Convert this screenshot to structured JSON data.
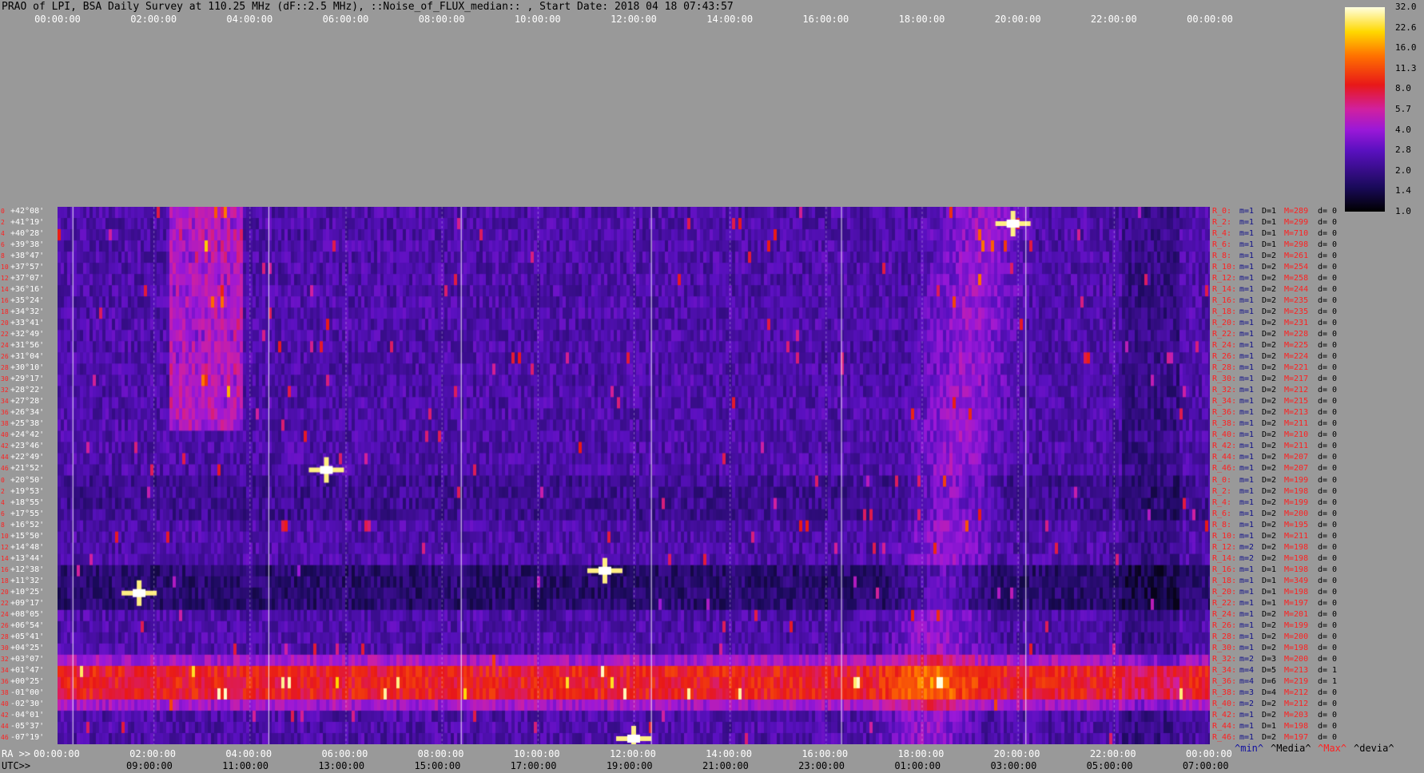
{
  "title": "PRAO of LPI, BSA Daily Survey at 110.25 MHz (dF::2.5 MHz), ::Noise_of_FLUX_median:: , Start Date: 2018 04 18 07:43:57",
  "top_axis": [
    "00:00:00",
    "02:00:00",
    "04:00:00",
    "06:00:00",
    "08:00:00",
    "10:00:00",
    "12:00:00",
    "14:00:00",
    "16:00:00",
    "18:00:00",
    "20:00:00",
    "22:00:00",
    "00:00:00"
  ],
  "ra_axis": {
    "prefix": "RA >>",
    "ticks": [
      "00:00:00",
      "02:00:00",
      "04:00:00",
      "06:00:00",
      "08:00:00",
      "10:00:00",
      "12:00:00",
      "14:00:00",
      "16:00:00",
      "18:00:00",
      "20:00:00",
      "22:00:00",
      "00:00:00"
    ]
  },
  "utc_axis": {
    "prefix": "UTC>>",
    "ticks": [
      "09:00:00",
      "11:00:00",
      "13:00:00",
      "15:00:00",
      "17:00:00",
      "19:00:00",
      "21:00:00",
      "23:00:00",
      "01:00:00",
      "03:00:00",
      "05:00:00",
      "07:00:00"
    ]
  },
  "left_labels": [
    "+42°08'",
    "+41°19'",
    "+40°28'",
    "+39°38'",
    "+38°47'",
    "+37°57'",
    "+37°07'",
    "+36°16'",
    "+35°24'",
    "+34°32'",
    "+33°41'",
    "+32°49'",
    "+31°56'",
    "+31°04'",
    "+30°10'",
    "+29°17'",
    "+28°22'",
    "+27°28'",
    "+26°34'",
    "+25°38'",
    "+24°42'",
    "+23°46'",
    "+22°49'",
    "+21°52'",
    "+20°50'",
    "+19°53'",
    "+18°55'",
    "+17°55'",
    "+16°52'",
    "+15°50'",
    "+14°48'",
    "+13°44'",
    "+12°38'",
    "+11°32'",
    "+10°25'",
    "+09°17'",
    "+08°05'",
    "+06°54'",
    "+05°41'",
    "+04°25'",
    "+03°07'",
    "+01°47'",
    "+00°25'",
    "-01°00'",
    "-02°30'",
    "-04°01'",
    "-05°37'",
    "-07°19'"
  ],
  "left_numbers": [
    "0",
    "2",
    "4",
    "6",
    "8",
    "10",
    "12",
    "14",
    "16",
    "18",
    "20",
    "22",
    "24",
    "26",
    "28",
    "30",
    "32",
    "34",
    "36",
    "38",
    "40",
    "42",
    "44",
    "46",
    "0",
    "2",
    "4",
    "6",
    "8",
    "10",
    "12",
    "14",
    "16",
    "18",
    "20",
    "22",
    "24",
    "26",
    "28",
    "30",
    "32",
    "34",
    "36",
    "38",
    "40",
    "42",
    "44",
    "46"
  ],
  "right_labels": [
    {
      "r": "R_0:",
      "m": "m=1",
      "d": "D=1",
      "M": "M=289",
      "dd": "d= 0"
    },
    {
      "r": "R_2:",
      "m": "m=1",
      "d": "D=1",
      "M": "M=299",
      "dd": "d= 0"
    },
    {
      "r": "R_4:",
      "m": "m=1",
      "d": "D=1",
      "M": "M=710",
      "dd": "d= 0"
    },
    {
      "r": "R_6:",
      "m": "m=1",
      "d": "D=1",
      "M": "M=298",
      "dd": "d= 0"
    },
    {
      "r": "R_8:",
      "m": "m=1",
      "d": "D=2",
      "M": "M=261",
      "dd": "d= 0"
    },
    {
      "r": "R_10:",
      "m": "m=1",
      "d": "D=2",
      "M": "M=254",
      "dd": "d= 0"
    },
    {
      "r": "R_12:",
      "m": "m=1",
      "d": "D=2",
      "M": "M=258",
      "dd": "d= 0"
    },
    {
      "r": "R_14:",
      "m": "m=1",
      "d": "D=2",
      "M": "M=244",
      "dd": "d= 0"
    },
    {
      "r": "R_16:",
      "m": "m=1",
      "d": "D=2",
      "M": "M=235",
      "dd": "d= 0"
    },
    {
      "r": "R_18:",
      "m": "m=1",
      "d": "D=2",
      "M": "M=235",
      "dd": "d= 0"
    },
    {
      "r": "R_20:",
      "m": "m=1",
      "d": "D=2",
      "M": "M=231",
      "dd": "d= 0"
    },
    {
      "r": "R_22:",
      "m": "m=1",
      "d": "D=2",
      "M": "M=228",
      "dd": "d= 0"
    },
    {
      "r": "R_24:",
      "m": "m=1",
      "d": "D=2",
      "M": "M=225",
      "dd": "d= 0"
    },
    {
      "r": "R_26:",
      "m": "m=1",
      "d": "D=2",
      "M": "M=224",
      "dd": "d= 0"
    },
    {
      "r": "R_28:",
      "m": "m=1",
      "d": "D=2",
      "M": "M=221",
      "dd": "d= 0"
    },
    {
      "r": "R_30:",
      "m": "m=1",
      "d": "D=2",
      "M": "M=217",
      "dd": "d= 0"
    },
    {
      "r": "R_32:",
      "m": "m=1",
      "d": "D=2",
      "M": "M=212",
      "dd": "d= 0"
    },
    {
      "r": "R_34:",
      "m": "m=1",
      "d": "D=2",
      "M": "M=215",
      "dd": "d= 0"
    },
    {
      "r": "R_36:",
      "m": "m=1",
      "d": "D=2",
      "M": "M=213",
      "dd": "d= 0"
    },
    {
      "r": "R_38:",
      "m": "m=1",
      "d": "D=2",
      "M": "M=211",
      "dd": "d= 0"
    },
    {
      "r": "R_40:",
      "m": "m=1",
      "d": "D=2",
      "M": "M=210",
      "dd": "d= 0"
    },
    {
      "r": "R_42:",
      "m": "m=1",
      "d": "D=2",
      "M": "M=211",
      "dd": "d= 0"
    },
    {
      "r": "R_44:",
      "m": "m=1",
      "d": "D=2",
      "M": "M=207",
      "dd": "d= 0"
    },
    {
      "r": "R_46:",
      "m": "m=1",
      "d": "D=2",
      "M": "M=207",
      "dd": "d= 0"
    },
    {
      "r": "R_0:",
      "m": "m=1",
      "d": "D=2",
      "M": "M=199",
      "dd": "d= 0"
    },
    {
      "r": "R_2:",
      "m": "m=1",
      "d": "D=2",
      "M": "M=198",
      "dd": "d= 0"
    },
    {
      "r": "R_4:",
      "m": "m=1",
      "d": "D=2",
      "M": "M=199",
      "dd": "d= 0"
    },
    {
      "r": "R_6:",
      "m": "m=1",
      "d": "D=2",
      "M": "M=200",
      "dd": "d= 0"
    },
    {
      "r": "R_8:",
      "m": "m=1",
      "d": "D=2",
      "M": "M=195",
      "dd": "d= 0"
    },
    {
      "r": "R_10:",
      "m": "m=1",
      "d": "D=2",
      "M": "M=211",
      "dd": "d= 0"
    },
    {
      "r": "R_12:",
      "m": "m=2",
      "d": "D=2",
      "M": "M=198",
      "dd": "d= 0"
    },
    {
      "r": "R_14:",
      "m": "m=2",
      "d": "D=2",
      "M": "M=198",
      "dd": "d= 0"
    },
    {
      "r": "R_16:",
      "m": "m=1",
      "d": "D=1",
      "M": "M=198",
      "dd": "d= 0"
    },
    {
      "r": "R_18:",
      "m": "m=1",
      "d": "D=1",
      "M": "M=349",
      "dd": "d= 0"
    },
    {
      "r": "R_20:",
      "m": "m=1",
      "d": "D=1",
      "M": "M=198",
      "dd": "d= 0"
    },
    {
      "r": "R_22:",
      "m": "m=1",
      "d": "D=1",
      "M": "M=197",
      "dd": "d= 0"
    },
    {
      "r": "R_24:",
      "m": "m=1",
      "d": "D=2",
      "M": "M=201",
      "dd": "d= 0"
    },
    {
      "r": "R_26:",
      "m": "m=1",
      "d": "D=2",
      "M": "M=199",
      "dd": "d= 0"
    },
    {
      "r": "R_28:",
      "m": "m=1",
      "d": "D=2",
      "M": "M=200",
      "dd": "d= 0"
    },
    {
      "r": "R_30:",
      "m": "m=1",
      "d": "D=2",
      "M": "M=198",
      "dd": "d= 0"
    },
    {
      "r": "R_32:",
      "m": "m=2",
      "d": "D=3",
      "M": "M=200",
      "dd": "d= 0"
    },
    {
      "r": "R_34:",
      "m": "m=4",
      "d": "D=5",
      "M": "M=213",
      "dd": "d= 1"
    },
    {
      "r": "R_36:",
      "m": "m=4",
      "d": "D=6",
      "M": "M=219",
      "dd": "d= 1"
    },
    {
      "r": "R_38:",
      "m": "m=3",
      "d": "D=4",
      "M": "M=212",
      "dd": "d= 0"
    },
    {
      "r": "R_40:",
      "m": "m=2",
      "d": "D=2",
      "M": "M=212",
      "dd": "d= 0"
    },
    {
      "r": "R_42:",
      "m": "m=1",
      "d": "D=2",
      "M": "M=203",
      "dd": "d= 0"
    },
    {
      "r": "R_44:",
      "m": "m=1",
      "d": "D=1",
      "M": "M=198",
      "dd": "d= 0"
    },
    {
      "r": "R_46:",
      "m": "m=1",
      "d": "D=2",
      "M": "M=197",
      "dd": "d= 0"
    }
  ],
  "colorbar_ticks": [
    "32.0",
    "22.6",
    "16.0",
    "11.3",
    "8.0",
    "5.7",
    "4.0",
    "2.8",
    "2.0",
    "1.4",
    "1.0"
  ],
  "legend": [
    {
      "text": "^min^",
      "color": "#1010a0"
    },
    {
      "text": "^Media^",
      "color": "#000000"
    },
    {
      "text": "^Max^",
      "color": "#ff2020"
    },
    {
      "text": "^devia^",
      "color": "#000000"
    }
  ],
  "colors": {
    "background": "#999999",
    "band_strong": "#ff3010",
    "noise": "#2a1070",
    "hot": "#ffd800",
    "label_red": "#ff2020",
    "label_blue": "#10108a",
    "label_white": "#ffffff"
  },
  "chart_data": {
    "type": "heatmap",
    "title": "PRAO of LPI, BSA Daily Survey at 110.25 MHz (dF::2.5 MHz), ::Noise_of_FLUX_median:: , Start Date: 2018 04 18 07:43:57",
    "x_axis": "RA 00:00:00 - 24:00:00 (top), UTC 09:00:00 - 07:00:00 (bottom)",
    "y_axis": "Declination +42°08' to -07°19' (48 beams)",
    "colorbar_range": [
      1.0,
      32.0
    ],
    "colorbar_scale": "log",
    "features": [
      {
        "name": "bright source",
        "ra_hours": 19.9,
        "beam_index": 1,
        "level": 32
      },
      {
        "name": "bright source",
        "ra_hours": 1.7,
        "beam_index": 34,
        "level": 32
      },
      {
        "name": "bright source",
        "ra_hours": 5.6,
        "beam_index": 23,
        "level": 22
      },
      {
        "name": "bright source",
        "ra_hours": 11.4,
        "beam_index": 32,
        "level": 22
      },
      {
        "name": "bright source",
        "ra_hours": 12.0,
        "beam_index": 47,
        "level": 32
      },
      {
        "name": "galactic plane",
        "ra_hours_start": 17.9,
        "ra_hours_end": 20.0,
        "beam_start": 0,
        "beam_end": 47
      },
      {
        "name": "strong band",
        "beam_start": 41,
        "beam_end": 44,
        "level": 8
      }
    ]
  }
}
